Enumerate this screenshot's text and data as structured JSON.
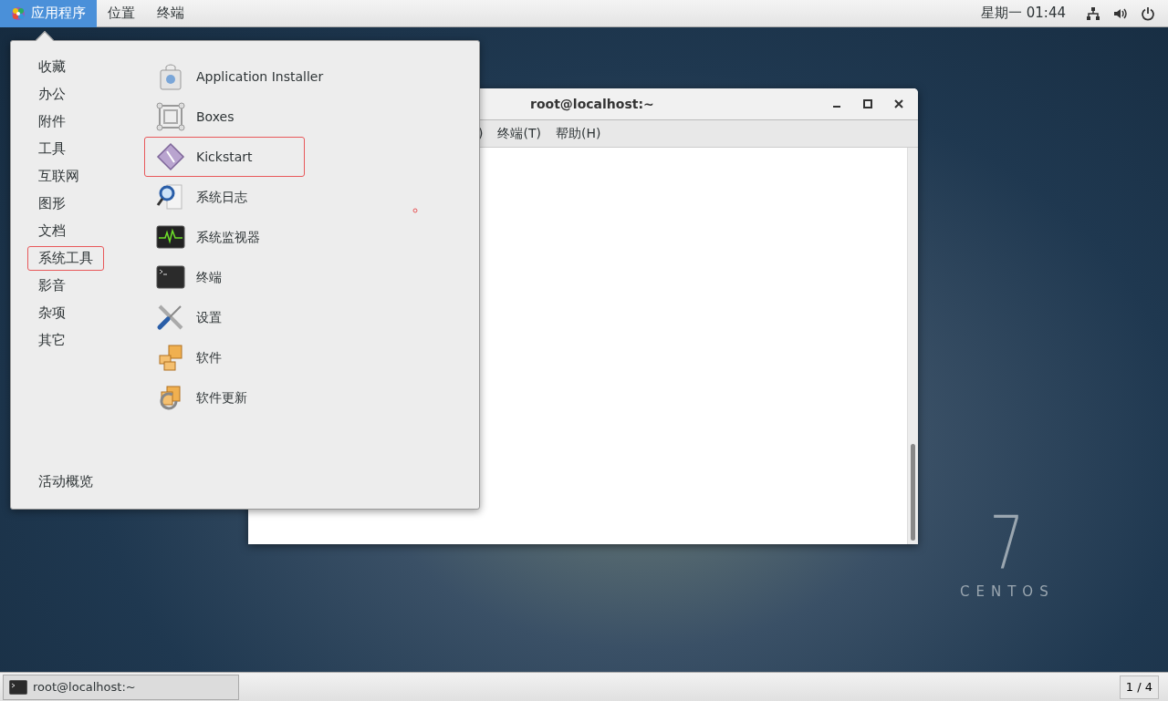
{
  "top_bar": {
    "menus": [
      {
        "label": "应用程序",
        "selected": true
      },
      {
        "label": "位置",
        "selected": false
      },
      {
        "label": "终端",
        "selected": false
      }
    ],
    "clock": "星期一 01:44"
  },
  "app_menu": {
    "categories": [
      {
        "label": "收藏",
        "highlighted": false
      },
      {
        "label": "办公",
        "highlighted": false
      },
      {
        "label": "附件",
        "highlighted": false
      },
      {
        "label": "工具",
        "highlighted": false
      },
      {
        "label": "互联网",
        "highlighted": false
      },
      {
        "label": "图形",
        "highlighted": false
      },
      {
        "label": "文档",
        "highlighted": false
      },
      {
        "label": "系统工具",
        "highlighted": true
      },
      {
        "label": "影音",
        "highlighted": false
      },
      {
        "label": "杂项",
        "highlighted": false
      },
      {
        "label": "其它",
        "highlighted": false
      }
    ],
    "overview": "活动概览",
    "apps": [
      {
        "label": "Application Installer",
        "kind": "bag",
        "highlighted": false
      },
      {
        "label": "Boxes",
        "kind": "boxes",
        "highlighted": false
      },
      {
        "label": "Kickstart",
        "kind": "diamond",
        "highlighted": true
      },
      {
        "label": "系统日志",
        "kind": "log",
        "highlighted": false
      },
      {
        "label": "系统监视器",
        "kind": "monitor",
        "highlighted": false
      },
      {
        "label": "终端",
        "kind": "terminal",
        "highlighted": false
      },
      {
        "label": "设置",
        "kind": "tools",
        "highlighted": false
      },
      {
        "label": "软件",
        "kind": "packages",
        "highlighted": false
      },
      {
        "label": "软件更新",
        "kind": "update",
        "highlighted": false
      }
    ]
  },
  "terminal": {
    "title": "root@localhost:~",
    "menus": [
      ")",
      "终端(T)",
      "帮助(H)"
    ]
  },
  "desktop": {
    "logo_number": "7",
    "logo_text": "CENTOS"
  },
  "taskbar": {
    "window": "root@localhost:~",
    "workspace": "1 / 4"
  }
}
